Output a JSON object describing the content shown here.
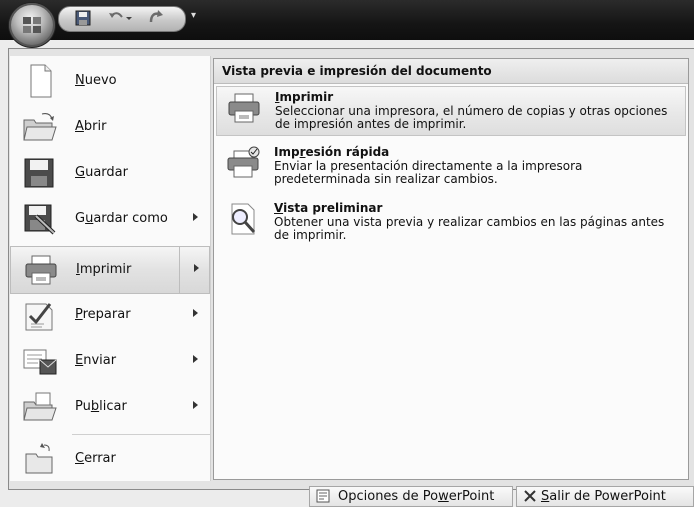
{
  "quick_access": {
    "icons": [
      "save-icon",
      "undo-icon",
      "redo-icon"
    ],
    "dropdown_glyph": "▾"
  },
  "menu": {
    "commands": [
      {
        "id": "nuevo",
        "label_pre": "",
        "label_key": "N",
        "label_post": "uevo",
        "icon": "new-document-icon",
        "submenu": false
      },
      {
        "id": "abrir",
        "label_pre": "",
        "label_key": "A",
        "label_post": "brir",
        "icon": "open-folder-icon",
        "submenu": false
      },
      {
        "id": "guardar",
        "label_pre": "",
        "label_key": "G",
        "label_post": "uardar",
        "icon": "save-disk-icon",
        "submenu": false
      },
      {
        "id": "guardar-como",
        "label_pre": "G",
        "label_key": "u",
        "label_post": "ardar como",
        "icon": "save-as-icon",
        "submenu": true
      },
      {
        "id": "imprimir",
        "label_pre": "",
        "label_key": "I",
        "label_post": "mprimir",
        "icon": "printer-icon",
        "submenu": true,
        "selected": true
      },
      {
        "id": "preparar",
        "label_pre": "",
        "label_key": "P",
        "label_post": "reparar",
        "icon": "prepare-icon",
        "submenu": true
      },
      {
        "id": "enviar",
        "label_pre": "",
        "label_key": "E",
        "label_post": "nviar",
        "icon": "send-icon",
        "submenu": true
      },
      {
        "id": "publicar",
        "label_pre": "Pu",
        "label_key": "b",
        "label_post": "licar",
        "icon": "publish-icon",
        "submenu": true
      },
      {
        "id": "cerrar",
        "label_pre": "",
        "label_key": "C",
        "label_post": "errar",
        "icon": "close-folder-icon",
        "submenu": false
      }
    ]
  },
  "submenu": {
    "header": "Vista previa e impresión del documento",
    "items": [
      {
        "title_pre": "",
        "title_key": "I",
        "title_post": "mprimir",
        "description": "Seleccionar una impresora, el número de copias y otras opciones de impresión antes de imprimir.",
        "icon": "printer-icon",
        "highlighted": true
      },
      {
        "title_pre": "Imp",
        "title_key": "r",
        "title_post": "esión rápida",
        "description": "Enviar la presentación directamente a la impresora predeterminada sin realizar cambios.",
        "icon": "quick-print-icon",
        "highlighted": false
      },
      {
        "title_pre": "",
        "title_key": "V",
        "title_post": "ista preliminar",
        "description": "Obtener una vista previa y realizar cambios en las páginas antes de imprimir.",
        "icon": "print-preview-icon",
        "highlighted": false
      }
    ]
  },
  "footer": {
    "options_pre": "Opciones de Po",
    "options_key": "w",
    "options_post": "erPoint",
    "exit_pre": "",
    "exit_key": "S",
    "exit_post": "alir de PowerPoint"
  }
}
